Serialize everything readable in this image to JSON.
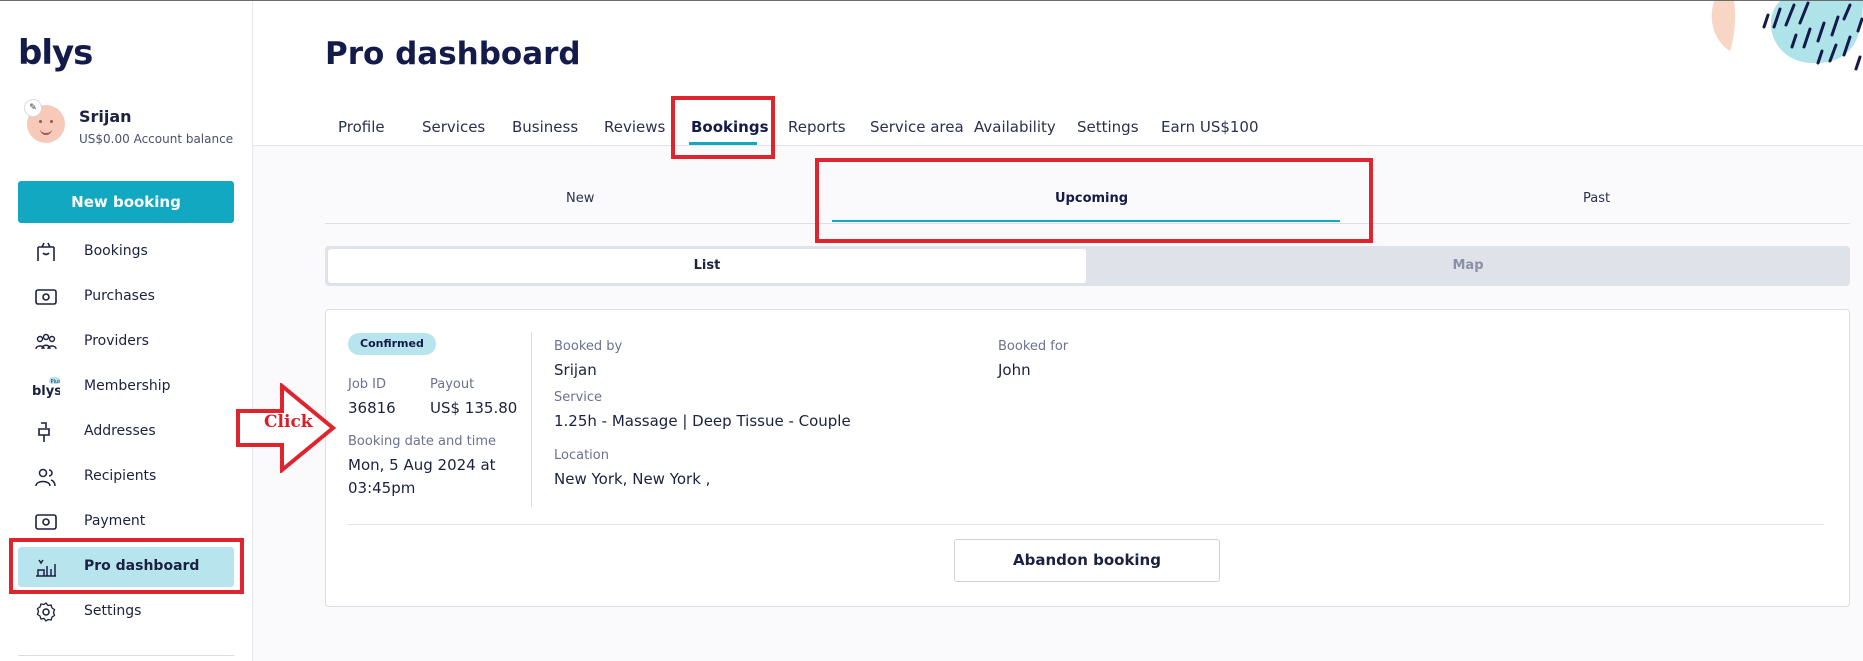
{
  "app": {
    "logo": "blys"
  },
  "user": {
    "name": "Srijan",
    "balance": "US$0.00 Account balance"
  },
  "sidebar": {
    "new_booking": "New booking",
    "items": [
      {
        "label": "Bookings",
        "icon": "bookings-icon"
      },
      {
        "label": "Purchases",
        "icon": "purchases-icon"
      },
      {
        "label": "Providers",
        "icon": "providers-icon"
      },
      {
        "label": "Membership",
        "icon": "blys-plus-icon"
      },
      {
        "label": "Addresses",
        "icon": "mailbox-icon"
      },
      {
        "label": "Recipients",
        "icon": "recipients-icon"
      },
      {
        "label": "Payment",
        "icon": "payment-icon"
      },
      {
        "label": "Pro dashboard",
        "icon": "pro-dashboard-icon",
        "active": true
      },
      {
        "label": "Settings",
        "icon": "gear-icon"
      }
    ]
  },
  "header": {
    "title": "Pro dashboard",
    "tabs": [
      "Profile",
      "Services",
      "Business",
      "Reviews",
      "Bookings",
      "Reports",
      "Service area",
      "Availability",
      "Settings",
      "Earn US$100"
    ],
    "active_tab": "Bookings"
  },
  "subtabs": {
    "items": [
      "New",
      "Upcoming",
      "Past"
    ],
    "active": "Upcoming"
  },
  "view_toggle": {
    "list": "List",
    "map": "Map",
    "active": "List"
  },
  "booking": {
    "status": "Confirmed",
    "job_id_label": "Job ID",
    "job_id": "36816",
    "payout_label": "Payout",
    "payout": "US$ 135.80",
    "datetime_label": "Booking date and time",
    "datetime_line1": "Mon, 5 Aug 2024 at",
    "datetime_line2": "03:45pm",
    "booked_by_label": "Booked by",
    "booked_by": "Srijan",
    "booked_for_label": "Booked for",
    "booked_for": "John",
    "service_label": "Service",
    "service": "1.25h - Massage | Deep Tissue - Couple",
    "location_label": "Location",
    "location": "New York, New York ,",
    "abandon": "Abandon booking"
  },
  "annotation": {
    "click": "Click",
    "color": "#e0242e"
  },
  "colors": {
    "accent": "#13a8c2",
    "active_bg": "#b8e4ed",
    "navy": "#141a4a"
  }
}
